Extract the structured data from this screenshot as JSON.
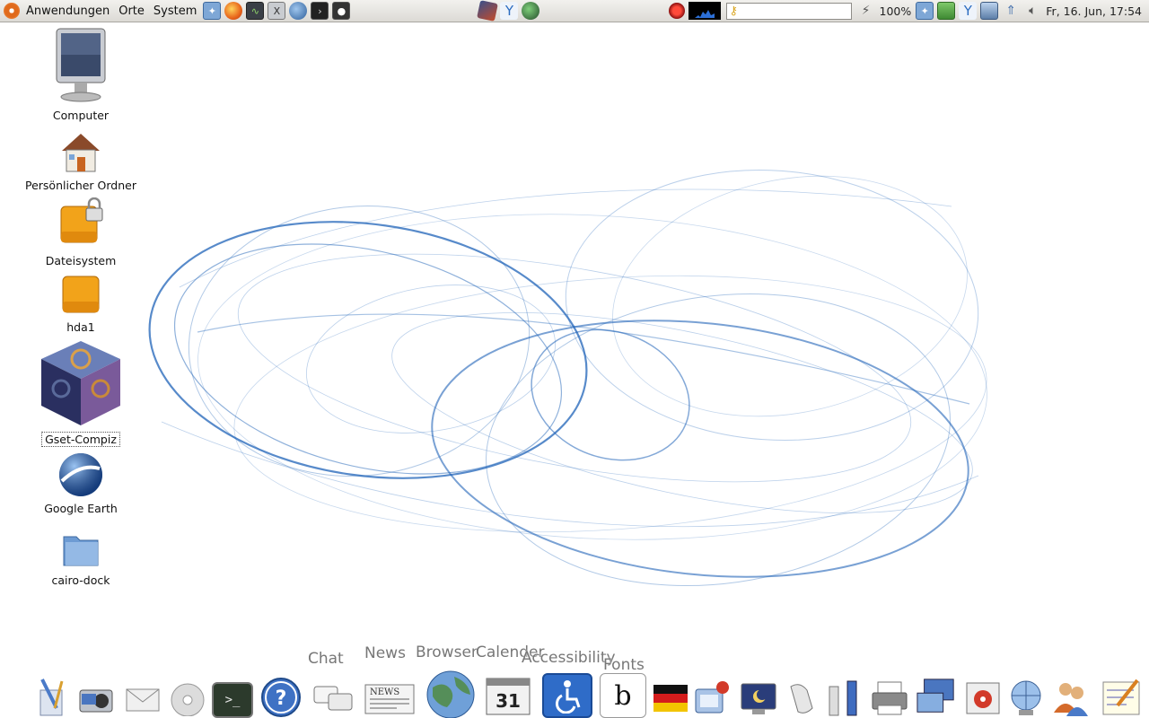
{
  "panel": {
    "menus": [
      "Anwendungen",
      "Orte",
      "System"
    ],
    "launchers": [
      "dictionary-icon",
      "firefox-icon",
      "system-monitor-icon",
      "xchat-icon",
      "thunderbird-icon",
      "terminal-icon",
      "screenshot-icon"
    ],
    "center_icons": [
      "cube-icon",
      "network-icon",
      "globe-icon"
    ],
    "record_icon": "record-icon",
    "monitor_icon": "system-load-graph-icon",
    "search_icon": "keys-icon",
    "battery_text": "100%",
    "tray_icons": [
      "battery-icon",
      "dictionary-tray-icon",
      "clipboard-icon",
      "network-tray-icon",
      "network-manager-icon",
      "updates-icon",
      "volume-icon"
    ],
    "clock": "Fr, 16. Jun, 17:54"
  },
  "desktop": {
    "icons": [
      {
        "label": "Computer",
        "icon": "computer-icon"
      },
      {
        "label": "Persönlicher Ordner",
        "icon": "home-folder-icon"
      },
      {
        "label": "Dateisystem",
        "icon": "filesystem-drive-icon"
      },
      {
        "label": "hda1",
        "icon": "hard-drive-icon"
      },
      {
        "label": "Gset-Compiz",
        "icon": "compiz-cube-icon"
      },
      {
        "label": "Google Earth",
        "icon": "google-earth-icon"
      },
      {
        "label": "cairo-dock",
        "icon": "folder-icon"
      }
    ]
  },
  "dock": {
    "labels": [
      "Chat",
      "News",
      "Browser",
      "Calender",
      "Accessibility",
      "Fonts"
    ],
    "icons": [
      "text-editor-icon",
      "camera-icon",
      "mail-icon",
      "cd-icon",
      "terminal-icon",
      "help-icon",
      "chat-icon",
      "news-icon",
      "browser-icon",
      "calendar-icon",
      "accessibility-icon",
      "fonts-icon",
      "german-flag-icon",
      "network-config-icon",
      "screensaver-icon",
      "mouse-icon",
      "usb-icon",
      "printer-icon",
      "remote-desktop-icon",
      "media-player-icon",
      "network-globe-icon",
      "users-icon",
      "notes-icon"
    ],
    "calendar_day": "31",
    "news_text": "NEWS"
  },
  "colors": {
    "accent_blue": "#1f63b8",
    "panel_bg": "#dcdad5"
  }
}
